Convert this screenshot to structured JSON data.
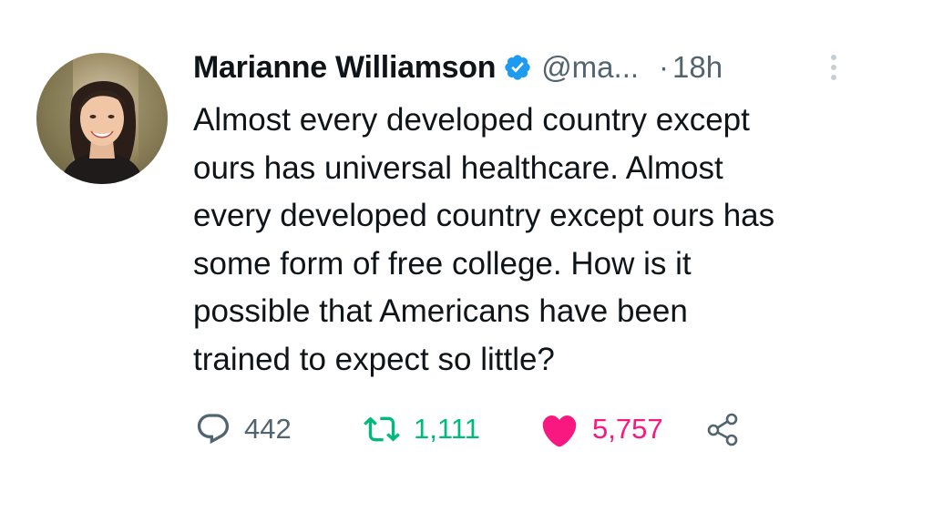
{
  "tweet": {
    "author": {
      "display_name": "Marianne Williamson",
      "handle": "@ma...",
      "verified_color": "#1d9bf0"
    },
    "separator": "·",
    "time": "18h",
    "lines": [
      "Almost every developed country except",
      "ours has universal healthcare. Almost",
      "every developed country except ours has",
      "some form of free college. How is it",
      "possible that Americans have been",
      "trained to expect so little?"
    ],
    "actions": {
      "replies": "442",
      "retweets": "1,111",
      "likes": "5,757",
      "retweet_color": "#00ba7c",
      "like_color": "#f91880"
    }
  }
}
